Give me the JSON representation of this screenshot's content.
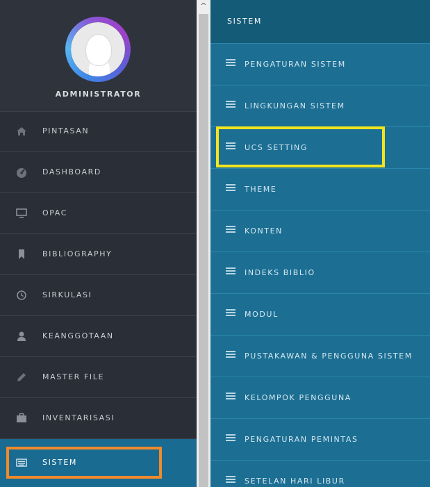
{
  "sidebar": {
    "user_name": "ADMINISTRATOR",
    "items": [
      {
        "label": "PINTASAN",
        "icon": "home-icon"
      },
      {
        "label": "DASHBOARD",
        "icon": "dashboard-icon"
      },
      {
        "label": "OPAC",
        "icon": "monitor-icon"
      },
      {
        "label": "BIBLIOGRAPHY",
        "icon": "bookmark-icon"
      },
      {
        "label": "SIRKULASI",
        "icon": "clock-icon"
      },
      {
        "label": "KEANGGOTAAN",
        "icon": "user-icon"
      },
      {
        "label": "MASTER FILE",
        "icon": "pencil-icon"
      },
      {
        "label": "INVENTARISASI",
        "icon": "briefcase-icon"
      },
      {
        "label": "SISTEM",
        "icon": "keyboard-icon",
        "active": true
      }
    ]
  },
  "submenu": {
    "header": "SISTEM",
    "items": [
      {
        "label": "PENGATURAN SISTEM"
      },
      {
        "label": "LINGKUNGAN SISTEM"
      },
      {
        "label": "UCS SETTING"
      },
      {
        "label": "THEME"
      },
      {
        "label": "KONTEN"
      },
      {
        "label": "INDEKS BIBLIO"
      },
      {
        "label": "MODUL"
      },
      {
        "label": "PUSTAKAWAN & PENGGUNA SISTEM"
      },
      {
        "label": "KELOMPOK PENGGUNA"
      },
      {
        "label": "PENGATURAN PEMINTAS"
      },
      {
        "label": "SETELAN HARI LIBUR"
      }
    ]
  },
  "colors": {
    "sidebar_bg": "#2a2e36",
    "active_bg": "#1a6b91",
    "submenu_bg": "#1c6f93",
    "highlight_orange": "#f08a2a",
    "highlight_yellow": "#f2e51f"
  }
}
